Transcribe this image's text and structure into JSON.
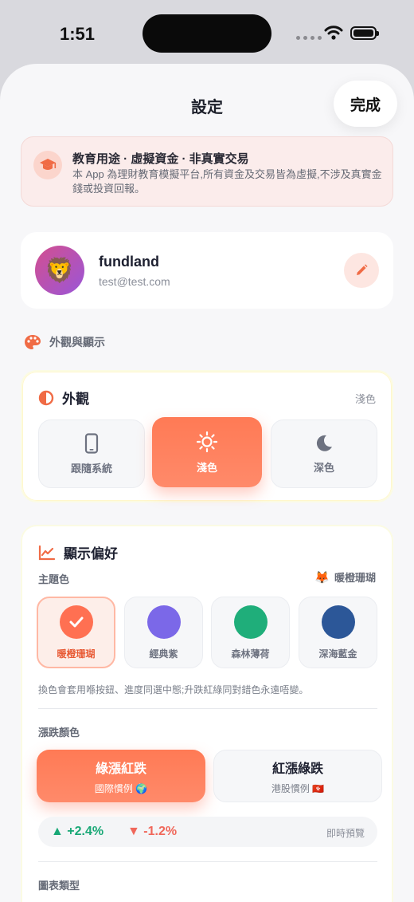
{
  "status_bar": {
    "time": "1:51"
  },
  "header": {
    "title": "設定",
    "done_label": "完成"
  },
  "notice": {
    "title": "教育用途 · 虛擬資金 · 非真實交易",
    "body": "本 App 為理財教育模擬平台,所有資金及交易皆為虛擬,不涉及真實金錢或投資回報。"
  },
  "profile": {
    "avatar_emoji": "🦁",
    "name": "fundland",
    "email": "test@test.com"
  },
  "section": {
    "appearance_display": "外觀與顯示"
  },
  "appearance": {
    "title": "外觀",
    "current": "淺色",
    "options": [
      {
        "label": "跟隨系統",
        "icon": "phone-icon"
      },
      {
        "label": "淺色",
        "icon": "sun-icon",
        "selected": true
      },
      {
        "label": "深色",
        "icon": "moon-icon"
      }
    ]
  },
  "display_prefs": {
    "title": "顯示偏好",
    "theme_label": "主題色",
    "theme_selected_emoji": "🦊",
    "theme_selected": "暖橙珊瑚",
    "themes": [
      {
        "label": "暖橙珊瑚",
        "color": "#ff7052",
        "selected": true
      },
      {
        "label": "經典紫",
        "color": "#7b68e8"
      },
      {
        "label": "森林薄荷",
        "color": "#1fae7a"
      },
      {
        "label": "深海藍金",
        "color": "#2c5798"
      }
    ],
    "theme_hint": "換色會套用喺按鈕、進度同選中態;升跌紅綠同對錯色永遠唔變。",
    "trend_label": "漲跌顏色",
    "trend_options": [
      {
        "title": "綠漲紅跌",
        "subtitle": "國際慣例 🌍",
        "selected": true
      },
      {
        "title": "紅漲綠跌",
        "subtitle": "港股慣例 🇭🇰"
      }
    ],
    "preview_up": "▲ +2.4%",
    "preview_down": "▼ -1.2%",
    "preview_label": "即時預覽",
    "chart_type_label": "圖表類型"
  },
  "colors": {
    "accent": "#ff7a55",
    "up": "#19a876",
    "down": "#f0675a"
  }
}
